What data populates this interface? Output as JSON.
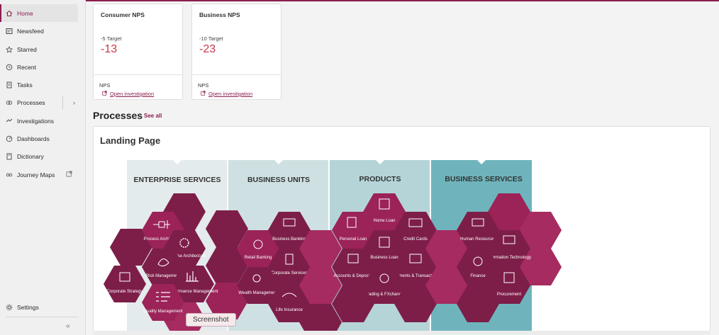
{
  "sidebar": {
    "items": [
      {
        "label": "Home",
        "icon": "home-icon"
      },
      {
        "label": "Newsfeed",
        "icon": "newsfeed-icon"
      },
      {
        "label": "Starred",
        "icon": "star-icon"
      },
      {
        "label": "Recent",
        "icon": "clock-icon"
      },
      {
        "label": "Tasks",
        "icon": "tasks-icon"
      },
      {
        "label": "Processes",
        "icon": "processes-icon",
        "trail": "›"
      },
      {
        "label": "Investigations",
        "icon": "investigation-icon"
      },
      {
        "label": "Dashboards",
        "icon": "dashboard-icon"
      },
      {
        "label": "Dictionary",
        "icon": "dictionary-icon"
      },
      {
        "label": "Journey Maps",
        "icon": "journey-icon"
      }
    ],
    "settings": "Settings",
    "collapse": "«",
    "active_color": "#8b1e4f"
  },
  "cards": [
    {
      "title": "Consumer NPS",
      "target": "-5 Target",
      "value": "-13",
      "label": "NPS",
      "link": "Open investigation"
    },
    {
      "title": "Business NPS",
      "target": "-10 Target",
      "value": "-23",
      "label": "NPS",
      "link": "Open investigation"
    }
  ],
  "processes": {
    "title": "Processes",
    "see_all": "See all"
  },
  "landing": {
    "title": "Landing Page",
    "columns": [
      {
        "label": "ENTERPRISE SERVICES",
        "color": "#e4ebec"
      },
      {
        "label": "BUSINESS UNITS",
        "color": "#cfe0e2"
      },
      {
        "label": "PRODUCTS",
        "color": "#b4d4d8"
      },
      {
        "label": "BUSINESS SERVICES",
        "color": "#6fb4bc"
      }
    ],
    "hex_labels": {
      "process_architecture": "Process Architecture",
      "enterprise_architecture": "Enterprise Architecture",
      "risk_management": "Risk Management",
      "corporate_strategy": "Corporate Strategy",
      "performance_management": "Performance Management",
      "quality_management": "Quality Management",
      "retail_banking": "Retail Banking",
      "business_banking": "Business Banking",
      "corporate_services": "Corporate Services",
      "wealth_management": "Wealth Management",
      "life_insurance": "Life Insurance",
      "home_loan": "Home Loan",
      "personal_loan": "Personal Loan",
      "credit_cards": "Credit Cards",
      "business_loan": "Business Loan",
      "accounts_deposits": "Accounts & Deposits",
      "payments_transactions": "Payments & Transactions",
      "trading_fxchange": "Trading & FXchange",
      "human_resources": "Human Resources",
      "information_technology": "Information Technology",
      "finance": "Finance",
      "procurement": "Procurement"
    },
    "hex_colors": {
      "dark": "#7d1e48",
      "mid": "#9b2358",
      "light": "#a62b61"
    }
  },
  "tooltip": "Screenshot"
}
